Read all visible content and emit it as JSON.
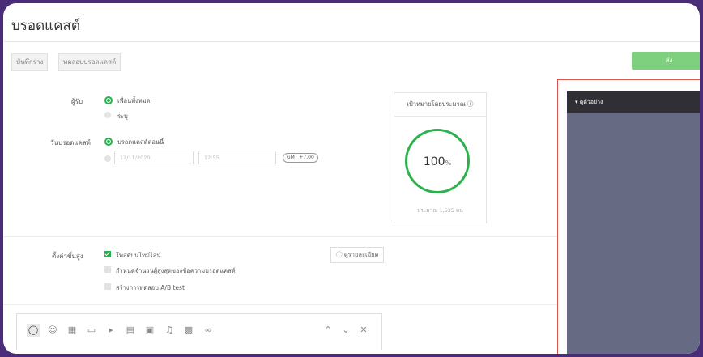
{
  "page": {
    "title": "บรอดแคสต์"
  },
  "toolbar": {
    "save_draft": "บันทึกร่าง",
    "test_broadcast": "ทดสอบบรอดแคสต์",
    "send": "ส่ง"
  },
  "recipients": {
    "label": "ผู้รับ",
    "all_friends": "เพื่อนทั้งหมด",
    "filter": "ระบุ"
  },
  "schedule": {
    "label": "วันบรอดแคสต์",
    "now": "บรอดแคสต์ตอนนี้",
    "date_placeholder": "12/11/2020",
    "time_placeholder": "12:55",
    "timezone": "GMT +7.00"
  },
  "target": {
    "title": "เป้าหมายโดยประมาณ ⓘ",
    "percent": "100",
    "percent_unit": "%",
    "estimate": "ประมาณ 1,535 คน"
  },
  "advanced": {
    "label": "ตั้งค่าขั้นสูง",
    "timeline_post": "โพสต์บนไทม์ไลน์",
    "limit_recipients": "กำหนดจำนวนผู้สูงสุดของข้อความบรอดแคสต์",
    "ab_test": "สร้างการทดสอบ A/B test",
    "details_button": "ⓘ ดูรายละเอียด"
  },
  "editor": {
    "tools": [
      "chat-bubble",
      "sticker",
      "image",
      "coupon",
      "video",
      "card",
      "rich-message",
      "voice",
      "survey",
      "link"
    ]
  },
  "preview": {
    "header": "▾ ดูตัวอย่าง"
  },
  "colors": {
    "accent": "#24b24b",
    "send_button": "#7ed07e",
    "preview_border": "#d9534f",
    "phone_bg": "#666b83",
    "frame": "#4a2c78"
  }
}
